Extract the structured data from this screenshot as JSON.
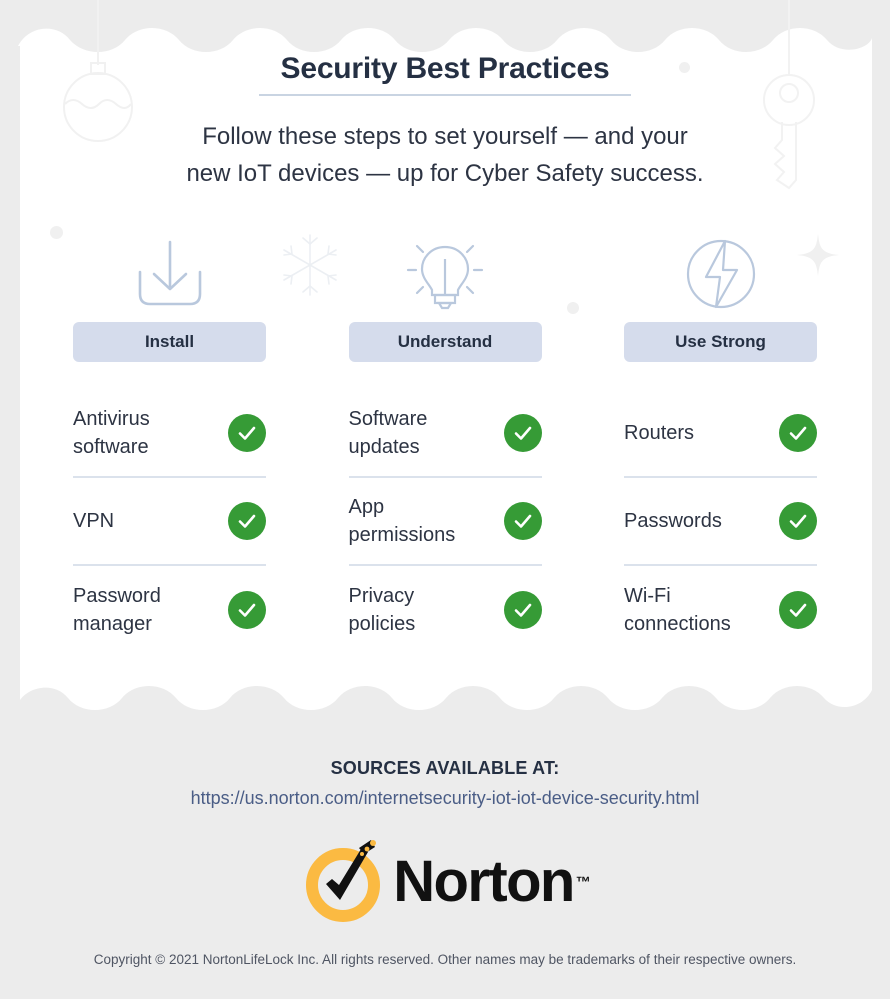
{
  "header": {
    "title": "Security Best Practices",
    "subtitle_line1": "Follow these steps to set yourself — and your",
    "subtitle_line2": "new IoT devices — up for Cyber Safety success."
  },
  "columns": [
    {
      "icon": "download-tray-icon",
      "heading": "Install",
      "rows": [
        {
          "label_line1": "Antivirus",
          "label_line2": "software",
          "status": "check"
        },
        {
          "label_line1": "VPN",
          "label_line2": "",
          "status": "check"
        },
        {
          "label_line1": "Password",
          "label_line2": "manager",
          "status": "check"
        }
      ]
    },
    {
      "icon": "lightbulb-icon",
      "heading": "Understand",
      "rows": [
        {
          "label_line1": "Software",
          "label_line2": "updates",
          "status": "check"
        },
        {
          "label_line1": "App",
          "label_line2": "permissions",
          "status": "check"
        },
        {
          "label_line1": "Privacy",
          "label_line2": "policies",
          "status": "check"
        }
      ]
    },
    {
      "icon": "lightning-bolt-circle-icon",
      "heading": "Use Strong",
      "rows": [
        {
          "label_line1": "Routers",
          "label_line2": "",
          "status": "check"
        },
        {
          "label_line1": "Passwords",
          "label_line2": "",
          "status": "check"
        },
        {
          "label_line1": "Wi-Fi",
          "label_line2": "connections",
          "status": "check"
        }
      ]
    }
  ],
  "footer": {
    "sources_label": "SOURCES AVAILABLE AT:",
    "sources_url": "https://us.norton.com/internetsecurity-iot-iot-device-security.html",
    "logo_wordmark": "Norton",
    "logo_trademark": "™",
    "copyright": "Copyright © 2021 NortonLifeLock Inc. All rights reserved. Other names may be trademarks of their respective owners."
  },
  "decorations": [
    {
      "name": "hanging-ornament-bauble"
    },
    {
      "name": "hanging-key"
    },
    {
      "name": "snowflake"
    },
    {
      "name": "sparkle-plus"
    },
    {
      "name": "dot-left"
    },
    {
      "name": "dot-center"
    },
    {
      "name": "dot-top-right"
    }
  ],
  "colors": {
    "page_background": "#ececec",
    "card_background": "#ffffff",
    "title_text": "#253043",
    "pill_background": "#d5dcec",
    "check_green": "#369b36",
    "divider": "#dbe2ec",
    "link": "#4a5d86",
    "logo_ring": "#fbba42"
  }
}
